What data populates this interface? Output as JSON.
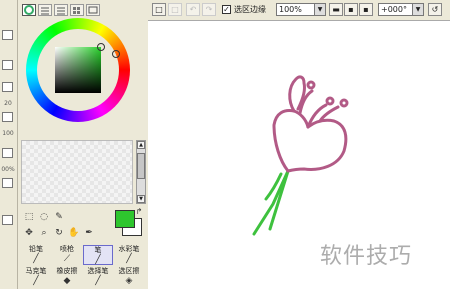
{
  "left_strip": {
    "values": [
      "20",
      "100",
      "00%"
    ]
  },
  "color_panel": {
    "foreground_color": "#2ec62e",
    "background_color": "#ffffff"
  },
  "brushes": [
    {
      "label": "铅笔",
      "selected": false
    },
    {
      "label": "喷枪",
      "selected": false
    },
    {
      "label": "笔",
      "selected": true
    },
    {
      "label": "水彩笔",
      "selected": false
    },
    {
      "label": "马克笔",
      "selected": false
    },
    {
      "label": "橡皮擦",
      "selected": false
    },
    {
      "label": "选择笔",
      "selected": false
    },
    {
      "label": "选区擦",
      "selected": false
    }
  ],
  "toolbar": {
    "selection_edge_label": "选区边缘",
    "selection_edge_checked": true,
    "zoom_value": "100%",
    "rotation_value": "+000°"
  },
  "watermark": "软件技巧",
  "colors": {
    "stem": "#3ec13e",
    "flower": "#b25a86"
  }
}
